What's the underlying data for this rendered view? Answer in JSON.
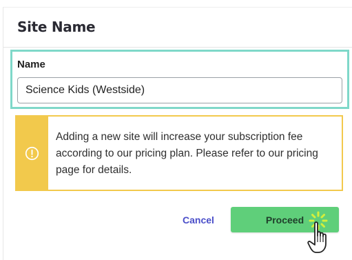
{
  "dialog": {
    "title": "Site Name"
  },
  "form": {
    "name_label": "Name",
    "name_value": "Science Kids (Westside)"
  },
  "alert": {
    "icon": "warning-circle-icon",
    "message": "Adding a new site will increase your subscription fee according to our pricing plan. Please refer to our pricing page for details."
  },
  "actions": {
    "cancel_label": "Cancel",
    "proceed_label": "Proceed"
  },
  "colors": {
    "focus_border": "#7fd8c9",
    "alert_yellow": "#f2c94c",
    "proceed_green": "#5fcf7a",
    "cancel_blue": "#4a4ec9"
  },
  "cursor": {
    "icon": "hand-pointer-icon",
    "click_effect": "click-burst-icon"
  }
}
